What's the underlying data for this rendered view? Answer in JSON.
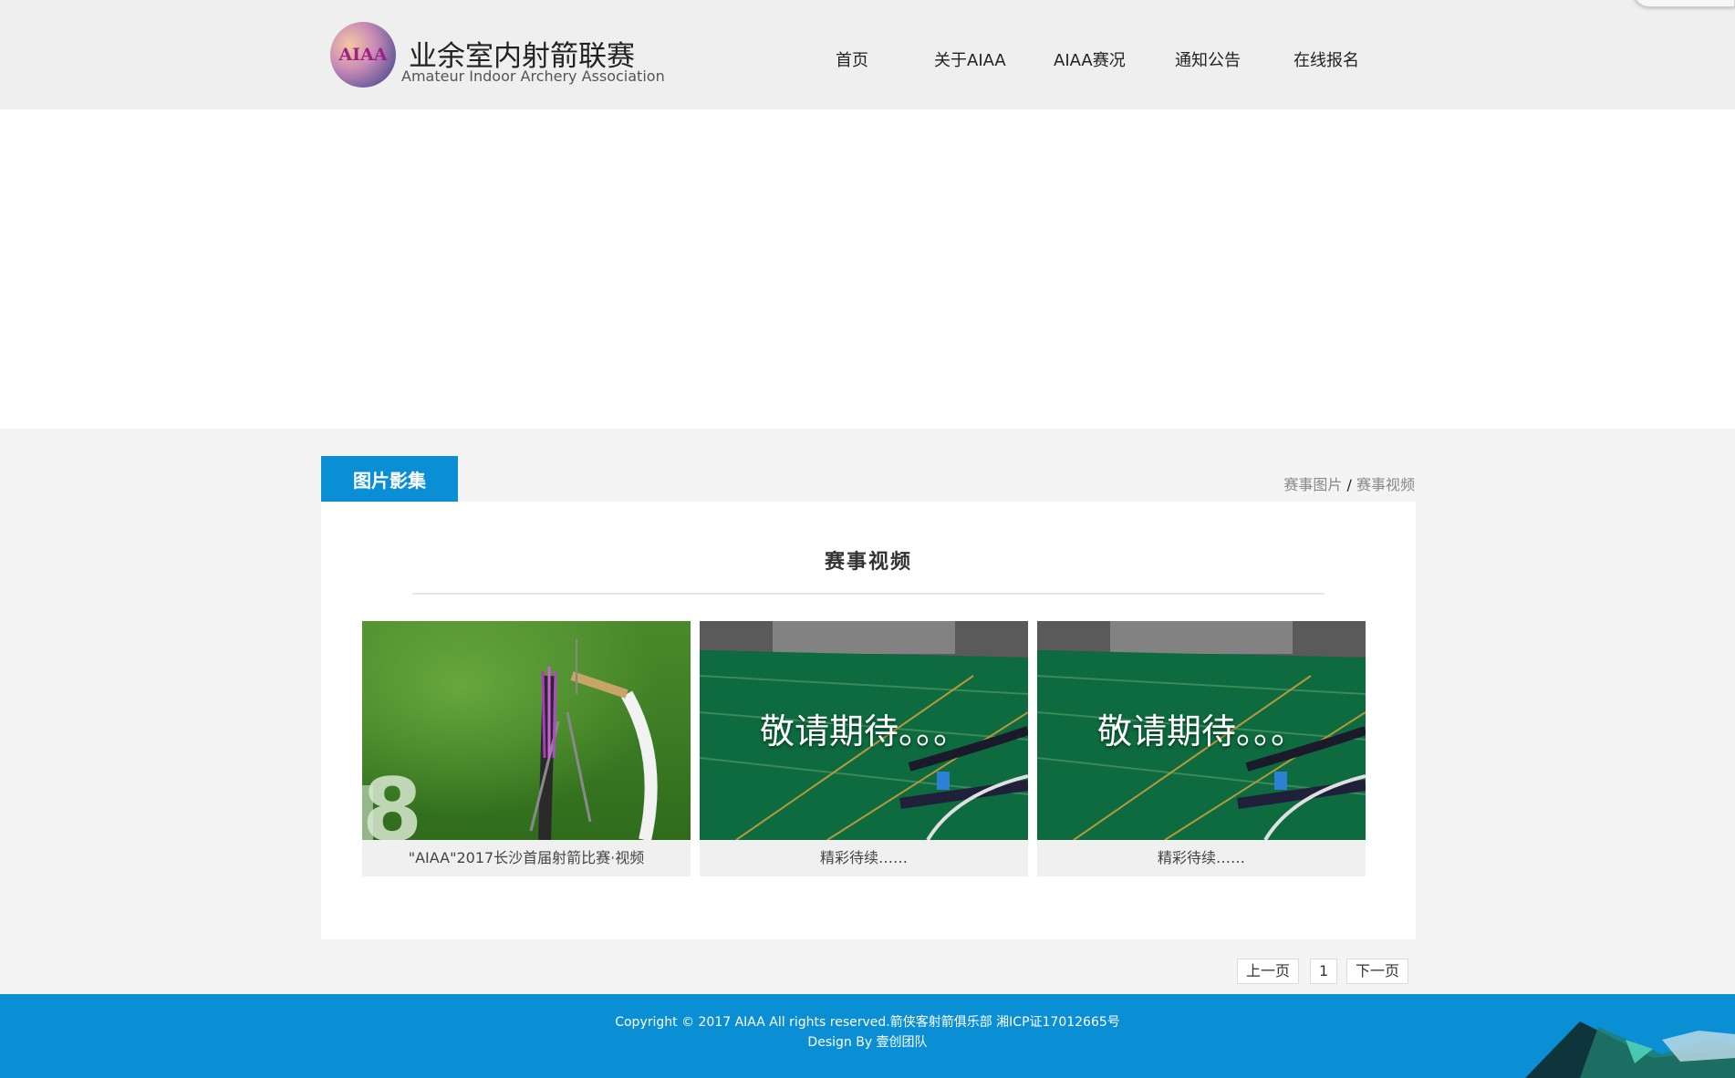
{
  "header": {
    "logo_text": "AIAA",
    "title": "业余室内射箭联赛",
    "subtitle": "Amateur Indoor Archery Association"
  },
  "nav": {
    "items": [
      {
        "label": "首页"
      },
      {
        "label": "关于AIAA"
      },
      {
        "label": "AIAA赛况"
      },
      {
        "label": "通知公告"
      },
      {
        "label": "在线报名"
      }
    ]
  },
  "section": {
    "tab_label": "图片影集",
    "breadcrumb": {
      "link1": "赛事图片",
      "separator": "/",
      "link2": "赛事视频"
    },
    "panel_title": "赛事视频"
  },
  "cards": [
    {
      "caption": "\"AIAA\"2017长沙首届射箭比赛·视频",
      "overlay": ""
    },
    {
      "caption": "精彩待续……",
      "overlay": "敬请期待。。。"
    },
    {
      "caption": "精彩待续……",
      "overlay": "敬请期待。。。"
    }
  ],
  "pagination": {
    "prev": "上一页",
    "current": "1",
    "next": "下一页"
  },
  "footer": {
    "copyright": "Copyright © 2017 AIAA All rights reserved.箭侠客射箭俱乐部 湘ICP证17012665号",
    "design": "Design By 壹创团队"
  },
  "colors": {
    "accent": "#0b8fd4",
    "header_bg": "#efefef",
    "page_bg": "#f4f4f4"
  }
}
